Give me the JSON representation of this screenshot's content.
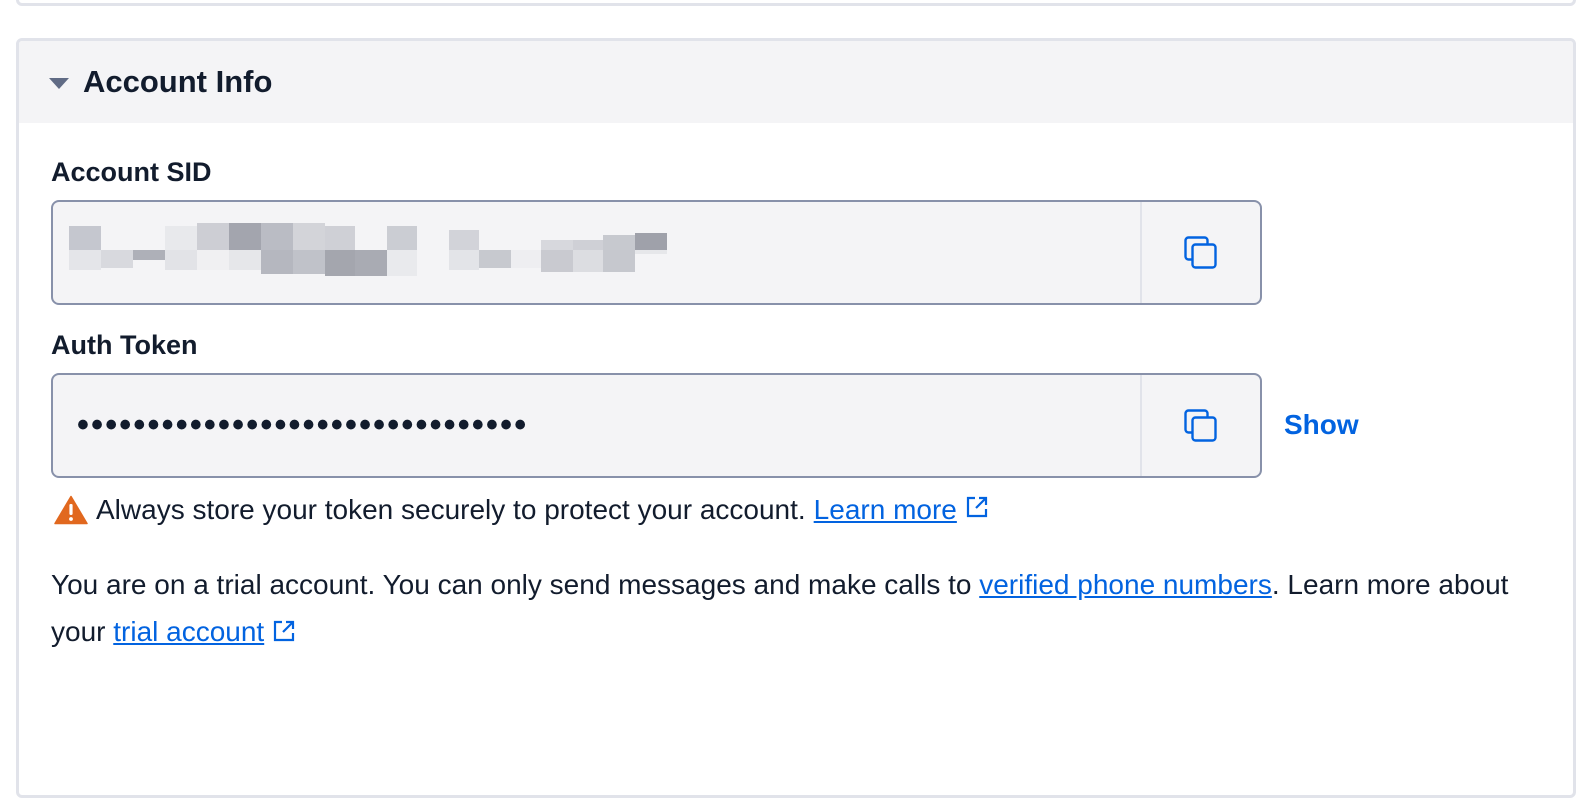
{
  "account_info": {
    "title": "Account Info",
    "account_sid": {
      "label": "Account SID"
    },
    "auth_token": {
      "label": "Auth Token",
      "masked_value": "••••••••••••••••••••••••••••••••",
      "show_label": "Show"
    },
    "warning": {
      "text": "Always store your token securely to protect your account.",
      "link": "Learn more"
    },
    "trial": {
      "text_before": "You are on a trial account. You can only send messages and make calls to ",
      "link_verified": "verified phone numbers",
      "text_middle": ". Learn more about your ",
      "link_trial": "trial account"
    }
  },
  "icons": {
    "collapse": "caret-down-icon",
    "copy": "copy-icon",
    "warning": "warning-icon",
    "external": "external-link-icon"
  },
  "colors": {
    "accent": "#0263e0",
    "warning": "#e1681f",
    "text": "#121c2d",
    "border": "#8891aa",
    "field_bg": "#f4f4f6"
  }
}
